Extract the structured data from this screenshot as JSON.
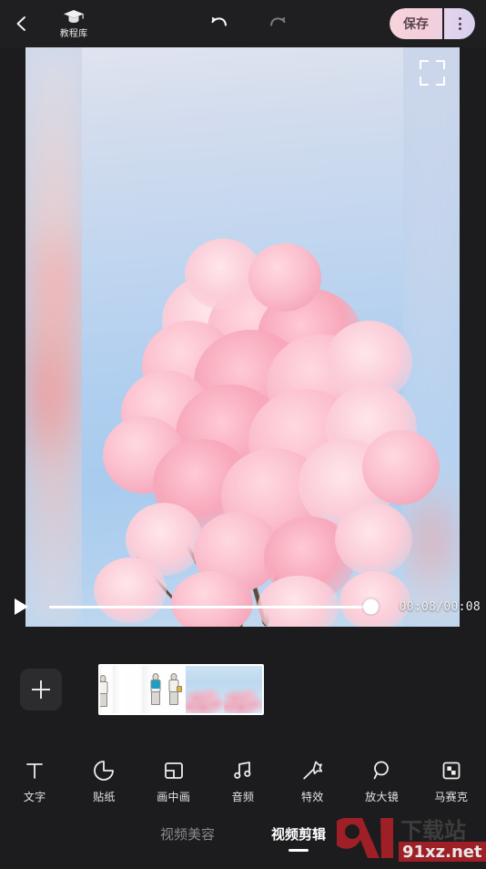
{
  "topbar": {
    "back_icon": "chevron-left-icon",
    "tutorial": {
      "icon": "graduation-cap-icon",
      "label": "教程库"
    },
    "undo_icon": "undo-arrow-icon",
    "redo_icon": "redo-arrow-icon",
    "save_label": "保存",
    "more_icon": "more-vertical-icon"
  },
  "preview": {
    "fullscreen_icon": "fullscreen-brackets-icon",
    "description": "cherry blossom video frame"
  },
  "playback": {
    "play_icon": "play-triangle-icon",
    "progress_percent": 100,
    "time_text": "00:08/00:08",
    "current_time": "00:08",
    "total_time": "00:08"
  },
  "clip_track": {
    "add_label": "+",
    "add_icon": "plus-icon",
    "selected_clip_name": "clip-thumbnail-strip"
  },
  "toolbar": {
    "items": [
      {
        "icon": "text-t-icon",
        "label": "文字"
      },
      {
        "icon": "sticker-icon",
        "label": "贴纸"
      },
      {
        "icon": "picture-in-picture-icon",
        "label": "画中画"
      },
      {
        "icon": "music-note-icon",
        "label": "音频"
      },
      {
        "icon": "magic-wand-icon",
        "label": "特效"
      },
      {
        "icon": "magnifier-icon",
        "label": "放大镜"
      },
      {
        "icon": "mosaic-icon",
        "label": "马赛克"
      }
    ]
  },
  "tabs": {
    "items": [
      {
        "label": "视频美容",
        "active": false
      },
      {
        "label": "视频剪辑",
        "active": true
      }
    ]
  },
  "watermark": {
    "logo": "91",
    "site_name": "下载站",
    "url": "91xz.net"
  },
  "colors": {
    "background": "#1c1c1e",
    "topbar": "#1f1f21",
    "save_pink": "#f4cfda",
    "save_lavender": "#d8cfee",
    "accent_white": "#ffffff",
    "inactive_text": "#8a8a8d",
    "watermark_red": "#a81f26"
  }
}
